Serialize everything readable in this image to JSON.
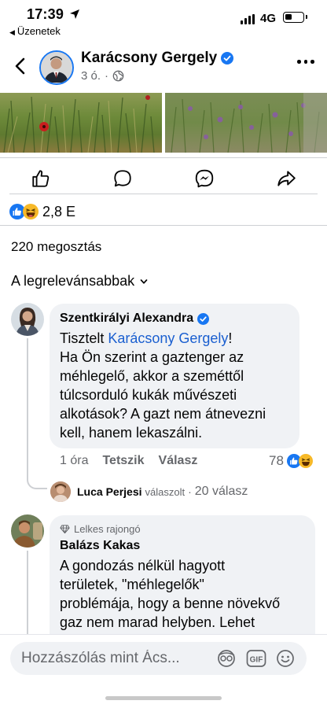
{
  "status_bar": {
    "time": "17:39",
    "back_app": "Üzenetek",
    "network": "4G"
  },
  "header": {
    "page_name": "Karácsony Gergely",
    "age": "3 ó.",
    "separator": "·"
  },
  "post": {
    "reaction_count": "2,8 E",
    "shares": "220 megosztás",
    "sort_label": "A legrelevánsabbak"
  },
  "comments": [
    {
      "author": "Szentkirályi Alexandra",
      "text_lead": "Tisztelt ",
      "mention": "Karácsony Gergely",
      "text_after_mention": "!",
      "text_lines": [
        "Ha Ön szerint a gaztenger az",
        "méhlegelő, akkor a szeméttől",
        "túlcsorduló kukák művészeti",
        "alkotások? A gazt nem átnevezni",
        "kell, hanem lekaszálni."
      ],
      "time": "1 óra",
      "like_label": "Tetszik",
      "reply_label": "Válasz",
      "reaction_count": "78",
      "reply_preview": {
        "author": "Luca Perjesi",
        "action": "válaszolt",
        "separator": "·",
        "count": "20 válasz"
      }
    },
    {
      "badge": "Lelkes rajongó",
      "author": "Balázs Kakas",
      "text_lines": [
        "A gondozás nélkül hagyott",
        "területek, \"méhlegelők\"",
        "problémája, hogy a benne növekvő",
        "gaz nem marad helyben. Lehet"
      ]
    }
  ],
  "composer": {
    "placeholder": "Hozzászólás mint Ács..."
  },
  "colors": {
    "accent": "#1877f2",
    "mention": "#1a5fd0",
    "bubble": "#f0f2f5",
    "secondary_text": "#65676b"
  }
}
